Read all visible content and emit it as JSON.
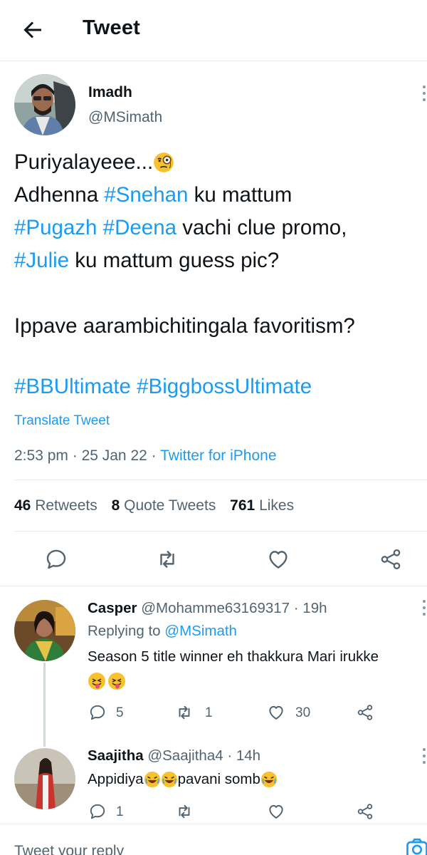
{
  "header": {
    "title": "Tweet"
  },
  "tweet": {
    "author_name": "Imadh",
    "author_handle": "@MSimath",
    "lines": [
      [
        {
          "t": "Puriyalayeee..."
        }
      ],
      [
        {
          "t": "Adhenna "
        },
        {
          "t": "#Snehan",
          "tag": true
        },
        {
          "t": " ku mattum"
        }
      ],
      [
        {
          "t": "#Pugazh",
          "tag": true
        },
        {
          "t": " "
        },
        {
          "t": "#Deena",
          "tag": true
        },
        {
          "t": " vachi clue promo,"
        }
      ],
      [
        {
          "t": "#Julie",
          "tag": true
        },
        {
          "t": " ku mattum guess pic?"
        }
      ],
      [
        {
          "t": ""
        }
      ],
      [
        {
          "t": "Ippave aarambichitingala favoritism?"
        }
      ]
    ],
    "hashtags": "#BBUltimate #BiggbossUltimate",
    "translate": "Translate Tweet",
    "time": "2:53 pm",
    "date": "25 Jan 22",
    "source": "Twitter for iPhone",
    "stats": {
      "retweets": "46",
      "retweets_label": "Retweets",
      "quotes": "8",
      "quotes_label": "Quote Tweets",
      "likes": "761",
      "likes_label": "Likes"
    }
  },
  "replies": [
    {
      "name": "Casper",
      "handle": "@Mohamme63169317",
      "time": "19h",
      "replying_prefix": "Replying to ",
      "replying_to": "@MSimath",
      "text": "Season 5 title winner eh thakkura Mari irukke",
      "counts": {
        "replies": "5",
        "retweets": "1",
        "likes": "30"
      }
    },
    {
      "name": "Saajitha",
      "handle": "@Saajitha4",
      "time": "14h",
      "text_a": "Appidiya",
      "text_b": "pavani somb",
      "counts": {
        "replies": "1",
        "retweets": "",
        "likes": ""
      }
    }
  ],
  "compose": {
    "placeholder": "Tweet your reply"
  },
  "colors": {
    "accent": "#1d9bf0",
    "text": "#0f1419",
    "secondary": "#536471",
    "divider": "#e6ecf0"
  }
}
